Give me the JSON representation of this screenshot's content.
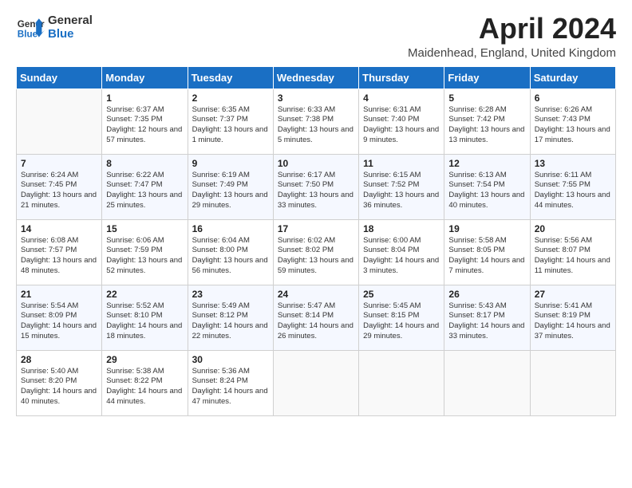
{
  "header": {
    "logo_line1": "General",
    "logo_line2": "Blue",
    "title": "April 2024",
    "subtitle": "Maidenhead, England, United Kingdom"
  },
  "weekdays": [
    "Sunday",
    "Monday",
    "Tuesday",
    "Wednesday",
    "Thursday",
    "Friday",
    "Saturday"
  ],
  "weeks": [
    [
      {
        "day": "",
        "empty": true
      },
      {
        "day": "1",
        "sunrise": "Sunrise: 6:37 AM",
        "sunset": "Sunset: 7:35 PM",
        "daylight": "Daylight: 12 hours and 57 minutes."
      },
      {
        "day": "2",
        "sunrise": "Sunrise: 6:35 AM",
        "sunset": "Sunset: 7:37 PM",
        "daylight": "Daylight: 13 hours and 1 minute."
      },
      {
        "day": "3",
        "sunrise": "Sunrise: 6:33 AM",
        "sunset": "Sunset: 7:38 PM",
        "daylight": "Daylight: 13 hours and 5 minutes."
      },
      {
        "day": "4",
        "sunrise": "Sunrise: 6:31 AM",
        "sunset": "Sunset: 7:40 PM",
        "daylight": "Daylight: 13 hours and 9 minutes."
      },
      {
        "day": "5",
        "sunrise": "Sunrise: 6:28 AM",
        "sunset": "Sunset: 7:42 PM",
        "daylight": "Daylight: 13 hours and 13 minutes."
      },
      {
        "day": "6",
        "sunrise": "Sunrise: 6:26 AM",
        "sunset": "Sunset: 7:43 PM",
        "daylight": "Daylight: 13 hours and 17 minutes."
      }
    ],
    [
      {
        "day": "7",
        "sunrise": "Sunrise: 6:24 AM",
        "sunset": "Sunset: 7:45 PM",
        "daylight": "Daylight: 13 hours and 21 minutes."
      },
      {
        "day": "8",
        "sunrise": "Sunrise: 6:22 AM",
        "sunset": "Sunset: 7:47 PM",
        "daylight": "Daylight: 13 hours and 25 minutes."
      },
      {
        "day": "9",
        "sunrise": "Sunrise: 6:19 AM",
        "sunset": "Sunset: 7:49 PM",
        "daylight": "Daylight: 13 hours and 29 minutes."
      },
      {
        "day": "10",
        "sunrise": "Sunrise: 6:17 AM",
        "sunset": "Sunset: 7:50 PM",
        "daylight": "Daylight: 13 hours and 33 minutes."
      },
      {
        "day": "11",
        "sunrise": "Sunrise: 6:15 AM",
        "sunset": "Sunset: 7:52 PM",
        "daylight": "Daylight: 13 hours and 36 minutes."
      },
      {
        "day": "12",
        "sunrise": "Sunrise: 6:13 AM",
        "sunset": "Sunset: 7:54 PM",
        "daylight": "Daylight: 13 hours and 40 minutes."
      },
      {
        "day": "13",
        "sunrise": "Sunrise: 6:11 AM",
        "sunset": "Sunset: 7:55 PM",
        "daylight": "Daylight: 13 hours and 44 minutes."
      }
    ],
    [
      {
        "day": "14",
        "sunrise": "Sunrise: 6:08 AM",
        "sunset": "Sunset: 7:57 PM",
        "daylight": "Daylight: 13 hours and 48 minutes."
      },
      {
        "day": "15",
        "sunrise": "Sunrise: 6:06 AM",
        "sunset": "Sunset: 7:59 PM",
        "daylight": "Daylight: 13 hours and 52 minutes."
      },
      {
        "day": "16",
        "sunrise": "Sunrise: 6:04 AM",
        "sunset": "Sunset: 8:00 PM",
        "daylight": "Daylight: 13 hours and 56 minutes."
      },
      {
        "day": "17",
        "sunrise": "Sunrise: 6:02 AM",
        "sunset": "Sunset: 8:02 PM",
        "daylight": "Daylight: 13 hours and 59 minutes."
      },
      {
        "day": "18",
        "sunrise": "Sunrise: 6:00 AM",
        "sunset": "Sunset: 8:04 PM",
        "daylight": "Daylight: 14 hours and 3 minutes."
      },
      {
        "day": "19",
        "sunrise": "Sunrise: 5:58 AM",
        "sunset": "Sunset: 8:05 PM",
        "daylight": "Daylight: 14 hours and 7 minutes."
      },
      {
        "day": "20",
        "sunrise": "Sunrise: 5:56 AM",
        "sunset": "Sunset: 8:07 PM",
        "daylight": "Daylight: 14 hours and 11 minutes."
      }
    ],
    [
      {
        "day": "21",
        "sunrise": "Sunrise: 5:54 AM",
        "sunset": "Sunset: 8:09 PM",
        "daylight": "Daylight: 14 hours and 15 minutes."
      },
      {
        "day": "22",
        "sunrise": "Sunrise: 5:52 AM",
        "sunset": "Sunset: 8:10 PM",
        "daylight": "Daylight: 14 hours and 18 minutes."
      },
      {
        "day": "23",
        "sunrise": "Sunrise: 5:49 AM",
        "sunset": "Sunset: 8:12 PM",
        "daylight": "Daylight: 14 hours and 22 minutes."
      },
      {
        "day": "24",
        "sunrise": "Sunrise: 5:47 AM",
        "sunset": "Sunset: 8:14 PM",
        "daylight": "Daylight: 14 hours and 26 minutes."
      },
      {
        "day": "25",
        "sunrise": "Sunrise: 5:45 AM",
        "sunset": "Sunset: 8:15 PM",
        "daylight": "Daylight: 14 hours and 29 minutes."
      },
      {
        "day": "26",
        "sunrise": "Sunrise: 5:43 AM",
        "sunset": "Sunset: 8:17 PM",
        "daylight": "Daylight: 14 hours and 33 minutes."
      },
      {
        "day": "27",
        "sunrise": "Sunrise: 5:41 AM",
        "sunset": "Sunset: 8:19 PM",
        "daylight": "Daylight: 14 hours and 37 minutes."
      }
    ],
    [
      {
        "day": "28",
        "sunrise": "Sunrise: 5:40 AM",
        "sunset": "Sunset: 8:20 PM",
        "daylight": "Daylight: 14 hours and 40 minutes."
      },
      {
        "day": "29",
        "sunrise": "Sunrise: 5:38 AM",
        "sunset": "Sunset: 8:22 PM",
        "daylight": "Daylight: 14 hours and 44 minutes."
      },
      {
        "day": "30",
        "sunrise": "Sunrise: 5:36 AM",
        "sunset": "Sunset: 8:24 PM",
        "daylight": "Daylight: 14 hours and 47 minutes."
      },
      {
        "day": "",
        "empty": true
      },
      {
        "day": "",
        "empty": true
      },
      {
        "day": "",
        "empty": true
      },
      {
        "day": "",
        "empty": true
      }
    ]
  ]
}
